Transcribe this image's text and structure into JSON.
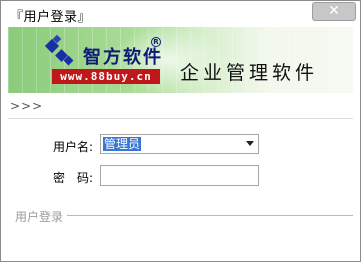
{
  "window": {
    "title": "『用户登录』",
    "close_glyph": "✕"
  },
  "banner": {
    "brand_name": "智方软件",
    "registered_mark": "R",
    "brand_url": "www.88buy.cn",
    "product_name": "企业管理软件",
    "colors": {
      "brand_blue": "#0e1a78",
      "url_red": "#c0171b",
      "banner_green": "#8acb7a"
    }
  },
  "breadcrumb": ">>>",
  "form": {
    "username_label": "用户名:",
    "username_value": "管理员",
    "password_label": "密　码:",
    "password_value": ""
  },
  "footer": {
    "group_label": "用户登录"
  },
  "icons": {
    "close": "close-icon",
    "dropdown": "chevron-down-icon",
    "logo": "logo-icon"
  }
}
